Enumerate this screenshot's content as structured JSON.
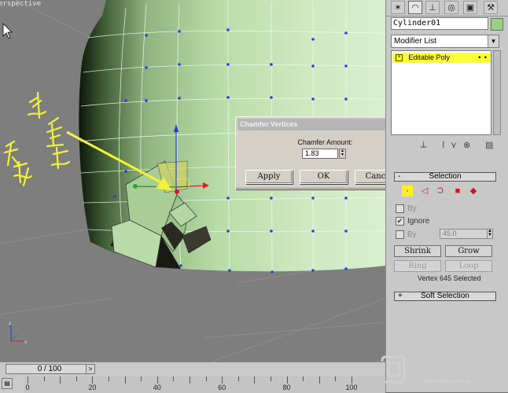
{
  "viewport": {
    "label": "erspective"
  },
  "annotation": {
    "handwritten": "选点后 分裂",
    "arrow_color": "#f2f23a"
  },
  "dialog": {
    "title": "Chamfer Vertices",
    "close": "×",
    "amount_label": "Chamfer Amount:",
    "amount_value": "1.83",
    "buttons": {
      "apply": "Apply",
      "ok": "OK",
      "cancel": "Cancel"
    }
  },
  "panel": {
    "tabs": [
      "create-icon",
      "modify-icon",
      "hierarchy-icon",
      "motion-icon",
      "display-icon",
      "utilities-icon"
    ],
    "object_name": "Cylinder01",
    "object_color": "#9bd08a",
    "modifier_list": "Modifier List",
    "stack": {
      "item": "Editable Poly",
      "highlight": "#ffff30"
    },
    "selection": {
      "title": "Selection",
      "by_vertex": "By",
      "ignore": "Ignore",
      "by_angle": "By",
      "angle_value": "45.0",
      "shrink": "Shrink",
      "grow": "Grow",
      "ring": "Ring",
      "loop": "Loop",
      "status": "Vertex 645 Selected"
    },
    "soft_selection": {
      "marker": "+",
      "title": "Soft Selection"
    }
  },
  "timeline": {
    "slider": "0 / 100",
    "ticks": [
      "0",
      "20",
      "40",
      "60",
      "80",
      "100"
    ]
  },
  "watermark": {
    "brand": "CG时代",
    "url": "www.cgtime.com.cn"
  }
}
